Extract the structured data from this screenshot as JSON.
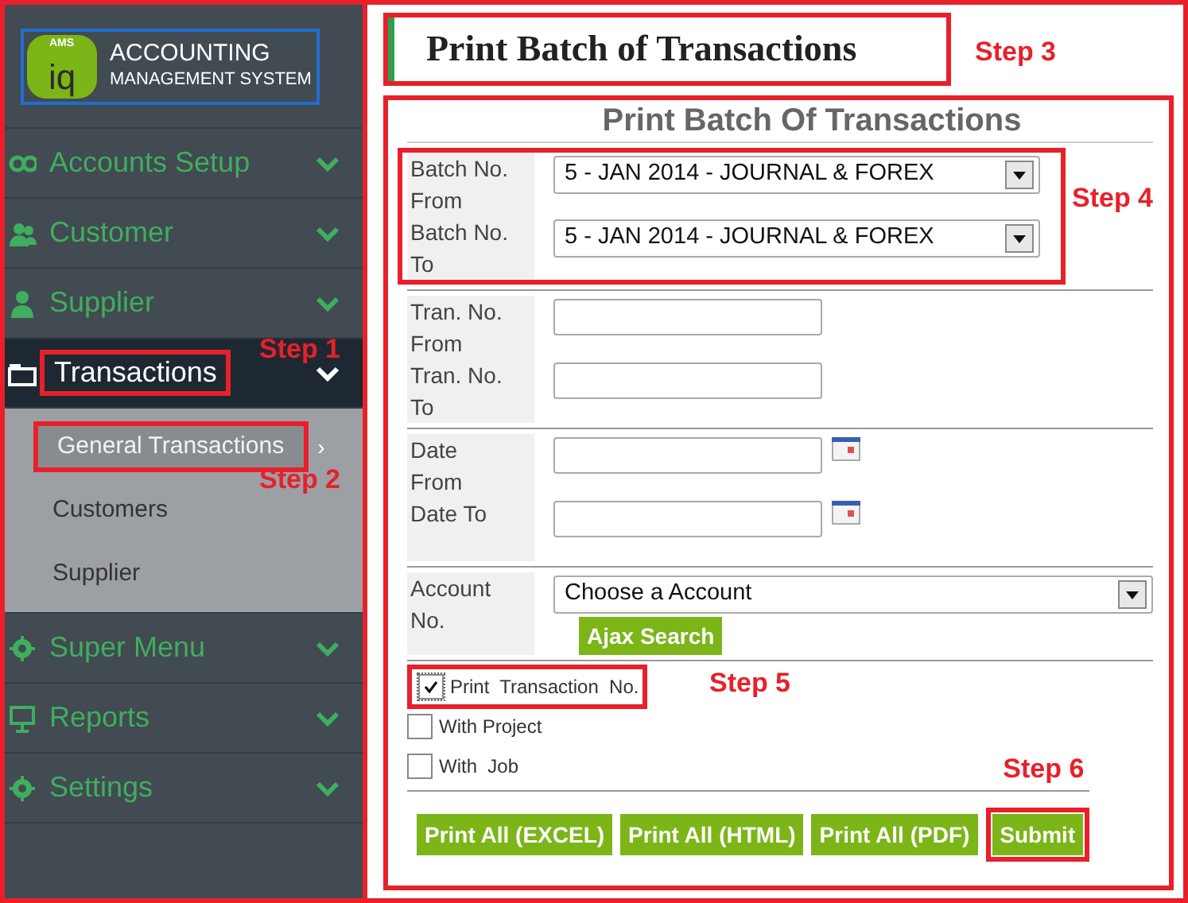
{
  "sidebar": {
    "logo": {
      "mark": "iq",
      "badge": "AMS",
      "title": "ACCOUNTING",
      "subtitle": "MANAGEMENT SYSTEM"
    },
    "items": [
      {
        "label": "Accounts Setup",
        "expanded": false
      },
      {
        "label": "Customer",
        "expanded": false
      },
      {
        "label": "Supplier",
        "expanded": false
      },
      {
        "label": "Transactions",
        "expanded": true,
        "step": "Step 1",
        "children": [
          {
            "label": "General Transactions",
            "selected": true,
            "arrow": "›",
            "step": "Step 2"
          },
          {
            "label": "Customers",
            "selected": false
          },
          {
            "label": "Supplier",
            "selected": false
          }
        ]
      },
      {
        "label": "Super Menu",
        "expanded": false
      },
      {
        "label": "Reports",
        "expanded": false
      },
      {
        "label": "Settings",
        "expanded": false
      }
    ]
  },
  "page_header": {
    "title": "Print Batch of Transactions",
    "step": "Step 3"
  },
  "form": {
    "title": "Print Batch Of Transactions",
    "groups": [
      {
        "step": "Step 4",
        "rows": [
          {
            "kind": "select",
            "label": "Batch No. From",
            "value": "5 - JAN 2014 - JOURNAL & FOREX"
          },
          {
            "kind": "select",
            "label": "Batch No. To",
            "value": "5 - JAN 2014 - JOURNAL & FOREX"
          }
        ]
      },
      {
        "rows": [
          {
            "kind": "text",
            "label": "Tran. No. From"
          },
          {
            "kind": "text",
            "label": "Tran. No. To"
          }
        ]
      },
      {
        "rows": [
          {
            "kind": "date",
            "label": "Date From"
          },
          {
            "kind": "date",
            "label": "Date To"
          }
        ]
      },
      {
        "rows": [
          {
            "kind": "account",
            "label": "Account No.",
            "value": "Choose a Account",
            "button": "Ajax Search"
          }
        ]
      }
    ],
    "checkboxes": [
      {
        "label": "Print  Transaction  No.",
        "checked": true,
        "step": "Step 5"
      },
      {
        "label": "With Project",
        "checked": false
      },
      {
        "label": "With  Job",
        "checked": false
      }
    ],
    "buttons": [
      {
        "label": "Print All (EXCEL)"
      },
      {
        "label": "Print All (HTML)"
      },
      {
        "label": "Print All (PDF)"
      },
      {
        "label": "Submit",
        "step": "Step 6"
      }
    ]
  }
}
